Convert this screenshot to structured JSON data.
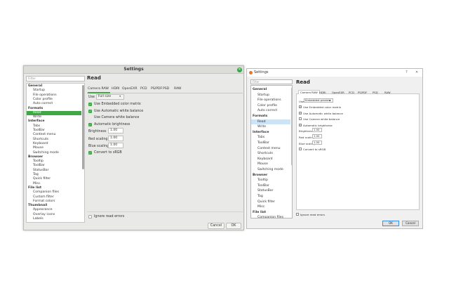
{
  "left_window": {
    "title": "Settings",
    "close_glyph": "✕",
    "filter_placeholder": "Filter",
    "tree": [
      {
        "label": "General",
        "kind": "cat"
      },
      {
        "label": "Startup",
        "kind": "sub"
      },
      {
        "label": "File operations",
        "kind": "sub"
      },
      {
        "label": "Color profile",
        "kind": "sub"
      },
      {
        "label": "Auto correct",
        "kind": "sub"
      },
      {
        "label": "Formats",
        "kind": "cat"
      },
      {
        "label": "Read",
        "kind": "sub",
        "selected": true
      },
      {
        "label": "Write",
        "kind": "sub"
      },
      {
        "label": "Interface",
        "kind": "cat"
      },
      {
        "label": "Tabs",
        "kind": "sub"
      },
      {
        "label": "ToolBar",
        "kind": "sub"
      },
      {
        "label": "Context menu",
        "kind": "sub"
      },
      {
        "label": "Shortcuts",
        "kind": "sub"
      },
      {
        "label": "Keyboard",
        "kind": "sub"
      },
      {
        "label": "Mouse",
        "kind": "sub"
      },
      {
        "label": "Switching mode",
        "kind": "sub"
      },
      {
        "label": "Browser",
        "kind": "cat"
      },
      {
        "label": "Tooltip",
        "kind": "sub"
      },
      {
        "label": "ToolBar",
        "kind": "sub"
      },
      {
        "label": "StatusBar",
        "kind": "sub"
      },
      {
        "label": "Tag",
        "kind": "sub"
      },
      {
        "label": "Quick filter",
        "kind": "sub"
      },
      {
        "label": "Misc.",
        "kind": "sub"
      },
      {
        "label": "File list",
        "kind": "cat"
      },
      {
        "label": "Companion files",
        "kind": "sub"
      },
      {
        "label": "Custom filter",
        "kind": "sub"
      },
      {
        "label": "Format colors",
        "kind": "sub"
      },
      {
        "label": "Thumbnail",
        "kind": "cat"
      },
      {
        "label": "Appearance",
        "kind": "sub"
      },
      {
        "label": "Overlay icons",
        "kind": "sub"
      },
      {
        "label": "Labels",
        "kind": "sub"
      }
    ],
    "section_title": "Read",
    "tabs": [
      "Camera RAW",
      "HDRI",
      "OpenEXR",
      "PCD",
      "PS/PDF",
      "PSD",
      "RAW"
    ],
    "use_label": "Use",
    "use_value": "Full size",
    "options": [
      {
        "label": "Use Embedded color matrix",
        "checked": true
      },
      {
        "label": "Use Automatic white balance",
        "checked": true
      },
      {
        "label": "Use Camera white balance",
        "checked": false
      },
      {
        "label": "Automatic brightness",
        "checked": true
      }
    ],
    "brightness_label": "Brightness",
    "brightness_value": "1.00",
    "red_label": "Red scaling",
    "red_value": "1.00",
    "blue_label": "Blue scaling",
    "blue_value": "1.00",
    "convert_label": "Convert to sRGB",
    "convert_checked": true,
    "ignore_label": "Ignore read errors",
    "cancel_label": "Cancel",
    "ok_label": "OK",
    "check_glyph": "✓",
    "accent_color": "#3fa845"
  },
  "right_window": {
    "title": "Settings",
    "help_glyph": "?",
    "close_glyph": "✕",
    "filter_placeholder": "Filter",
    "tree": [
      {
        "label": "General",
        "kind": "cat"
      },
      {
        "label": "Startup",
        "kind": "sub"
      },
      {
        "label": "File operations",
        "kind": "sub"
      },
      {
        "label": "Color profile",
        "kind": "sub"
      },
      {
        "label": "Auto correct",
        "kind": "sub"
      },
      {
        "label": "Formats",
        "kind": "cat"
      },
      {
        "label": "Read",
        "kind": "sub",
        "selected": true
      },
      {
        "label": "Write",
        "kind": "sub"
      },
      {
        "label": "Interface",
        "kind": "cat"
      },
      {
        "label": "Tabs",
        "kind": "sub"
      },
      {
        "label": "ToolBar",
        "kind": "sub"
      },
      {
        "label": "Context menu",
        "kind": "sub"
      },
      {
        "label": "Shortcuts",
        "kind": "sub"
      },
      {
        "label": "Keyboard",
        "kind": "sub"
      },
      {
        "label": "Mouse",
        "kind": "sub"
      },
      {
        "label": "Switching mode",
        "kind": "sub"
      },
      {
        "label": "Browser",
        "kind": "cat"
      },
      {
        "label": "Tooltip",
        "kind": "sub"
      },
      {
        "label": "ToolBar",
        "kind": "sub"
      },
      {
        "label": "StatusBar",
        "kind": "sub"
      },
      {
        "label": "Tag",
        "kind": "sub"
      },
      {
        "label": "Quick filter",
        "kind": "sub"
      },
      {
        "label": "Misc.",
        "kind": "sub"
      },
      {
        "label": "File list",
        "kind": "cat"
      },
      {
        "label": "Companion files",
        "kind": "sub"
      }
    ],
    "section_title": "Read",
    "tabs": [
      "Camera RAW",
      "HDRI",
      "OpenEXR",
      "PCD",
      "PS/PDF",
      "PSD",
      "RAW"
    ],
    "use_label": "Use",
    "use_value": "Embedded preview",
    "options": [
      {
        "label": "Use Embedded color matrix",
        "checked": true
      },
      {
        "label": "Use Automatic white balance",
        "checked": true
      },
      {
        "label": "Use Camera white balance",
        "checked": false
      },
      {
        "label": "Automatic brightness",
        "checked": true
      }
    ],
    "brightness_label": "Brightness",
    "brightness_value": "1.00",
    "red_label": "Red scaling",
    "red_value": "1.00",
    "blue_label": "Blue scaling",
    "blue_value": "1.00",
    "convert_label": "Convert to sRGB",
    "convert_checked": false,
    "ignore_label": "Ignore read errors",
    "ok_label": "OK",
    "cancel_label": "Cancel",
    "check_glyph": "✓"
  }
}
